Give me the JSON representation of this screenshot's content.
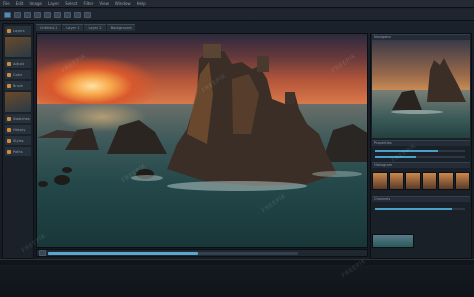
{
  "menubar": {
    "items": [
      "File",
      "Edit",
      "Image",
      "Layer",
      "Select",
      "Filter",
      "View",
      "Window",
      "Help"
    ]
  },
  "toolbar": {
    "buttons": [
      "move-icon",
      "marquee-icon",
      "lasso-icon",
      "crop-icon",
      "brush-icon",
      "eraser-icon",
      "gradient-icon",
      "text-icon",
      "zoom-icon"
    ],
    "accent_color": "#4a8fb8"
  },
  "tabs": [
    {
      "label": "Untitled-1"
    },
    {
      "label": "Layer 1"
    },
    {
      "label": "Layer 2"
    },
    {
      "label": "Background"
    }
  ],
  "left_panel": {
    "rows": [
      "Layers",
      "Adjust",
      "Color",
      "Brush",
      "Swatches",
      "History",
      "Styles",
      "Paths"
    ]
  },
  "right_panel": {
    "title": "Navigator",
    "sections": [
      "Properties",
      "Histogram",
      "Channels"
    ],
    "slider_levels": [
      0.7,
      0.45,
      0.85
    ]
  },
  "timeline": {
    "progress": 0.6
  },
  "watermark": "FREEPIK",
  "colors": {
    "sunset": "#f7a64a",
    "sea": "#24484a",
    "panel": "#1a2129"
  }
}
